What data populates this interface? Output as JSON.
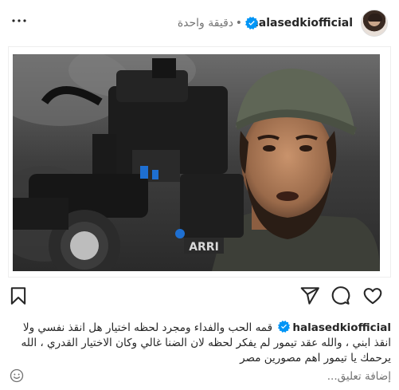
{
  "post": {
    "username": "halasedkiofficial",
    "time_ago": "دقيقة واحدة",
    "separator": "•",
    "verified": true,
    "image_alt_text": "ARRI"
  },
  "caption": {
    "username": "halasedkiofficial",
    "text": "قمه الحب والفداء ومجرد لحظه اختيار هل انقذ نفسي ولا انقذ ابني ، والله عقد تيمور لم يفكر لحظه لان الضنا غالي وكان الاختيار القدري ، الله يرحمك يا تيمور اهم مصورين مصر"
  },
  "comment": {
    "placeholder": "إضافة تعليق..."
  },
  "colors": {
    "text": "#262626",
    "muted": "#737373",
    "verified_blue": "#0095f6"
  }
}
